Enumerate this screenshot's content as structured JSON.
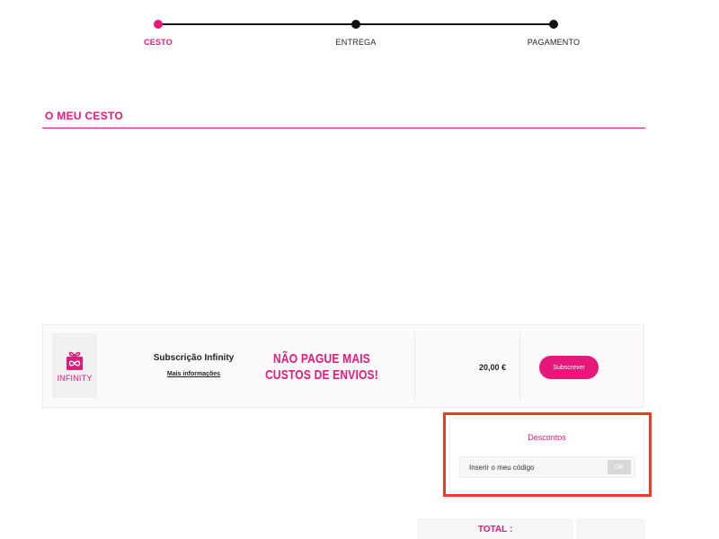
{
  "stepper": {
    "steps": [
      {
        "label": "CESTO",
        "active": true
      },
      {
        "label": "ENTREGA",
        "active": false
      },
      {
        "label": "PAGAMENTO",
        "active": false
      }
    ]
  },
  "cart": {
    "title": "O MEU CESTO"
  },
  "product": {
    "logo_text": "INFINITY",
    "name": "Subscrição Infinity",
    "more_info": "Mais informações",
    "promo_line1": "NÃO PAGUE MAIS",
    "promo_line2": "CUSTOS DE ENVIOS!",
    "price": "20,00 €",
    "subscribe_label": "Subscrever"
  },
  "discounts": {
    "title": "Descontos",
    "placeholder": "Inserir o meu código",
    "ok_label": "OK"
  },
  "total": {
    "label": "TOTAL :",
    "value": ""
  },
  "colors": {
    "accent": "#e6197a",
    "highlight": "#ef3b24"
  }
}
